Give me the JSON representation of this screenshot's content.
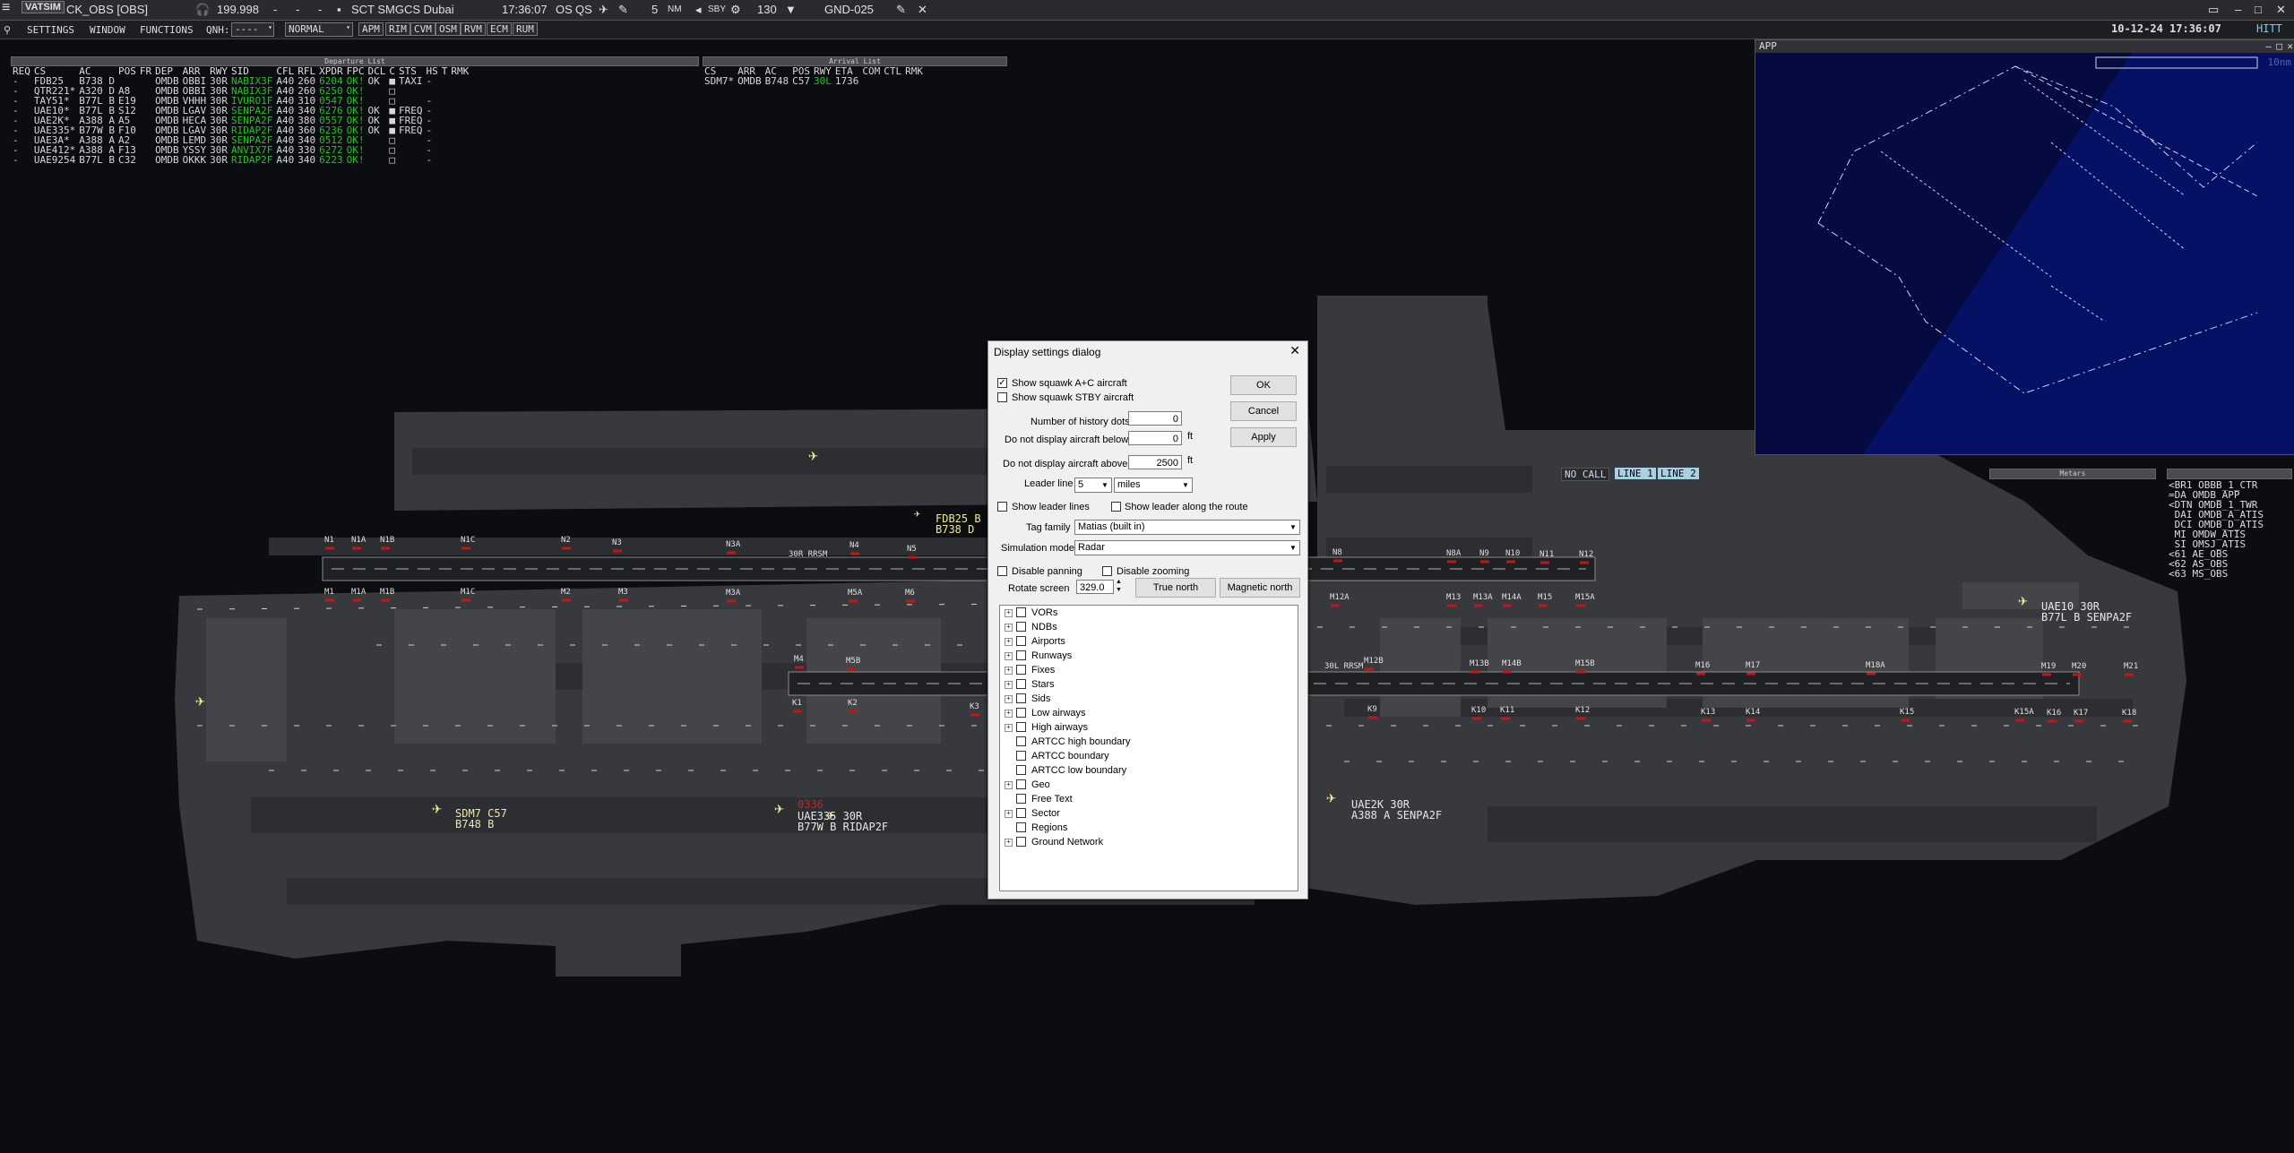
{
  "topbar": {
    "brand": "VATSIM",
    "callsign": "CK_OBS [OBS]",
    "frequency": "199.998",
    "dash1": "-",
    "dash2": "-",
    "dash3": "-",
    "sector_file": "SCT SMGCS Dubai",
    "time": "17:36:07",
    "os": "OS",
    "qs": "QS",
    "range": "5",
    "range_unit": "NM",
    "sby": "SBY",
    "squawk": "130",
    "position": "GND-025"
  },
  "menubar": {
    "settings": "SETTINGS",
    "window": "WINDOW",
    "functions": "FUNCTIONS",
    "qnh_label": "QNH:",
    "qnh_value": "----",
    "mode_value": "NORMAL",
    "apm": "APM",
    "rim": "RIM",
    "cvm": "CVM",
    "osm": "OSM",
    "rvm": "RVM",
    "ecm": "ECM",
    "rum": "RUM",
    "datetime": "10-12-24 17:36:07",
    "hitt": "HITT"
  },
  "departure_list": {
    "title": "Departure List",
    "headers": [
      "REQ",
      "CS",
      "AC",
      "POS",
      "FR",
      "DEP",
      "ARR",
      "RWY",
      "SID",
      "CFL",
      "RFL",
      "XPDR",
      "FPC",
      "DCL",
      "C",
      "STS",
      "HS",
      "T",
      "RMK"
    ],
    "rows": [
      [
        "-",
        "FDB25",
        "B738 D",
        "",
        "",
        "OMDB",
        "OBBI",
        "30R",
        "NABIX3F",
        "A40",
        "260",
        "6204",
        "OK!",
        "OK",
        "■",
        "TAXI",
        "-"
      ],
      [
        "-",
        "QTR221*",
        "A320 D",
        "A8",
        "",
        "OMDB",
        "OBBI",
        "30R",
        "NABIX3F",
        "A40",
        "260",
        "6250",
        "OK!",
        "",
        "□",
        "",
        ""
      ],
      [
        "-",
        "TAY51*",
        "B77L B",
        "E19",
        "",
        "OMDB",
        "VHHH",
        "30R",
        "IVURO1F",
        "A40",
        "310",
        "0547",
        "OK!",
        "",
        "□",
        "",
        "-"
      ],
      [
        "-",
        "UAE10*",
        "B77L B",
        "S12",
        "",
        "OMDB",
        "LGAV",
        "30R",
        "SENPA2F",
        "A40",
        "340",
        "6276",
        "OK!",
        "OK",
        "■",
        "FREQ",
        "-"
      ],
      [
        "-",
        "UAE2K*",
        "A388 A",
        "A5",
        "",
        "OMDB",
        "HECA",
        "30R",
        "SENPA2F",
        "A40",
        "380",
        "0557",
        "OK!",
        "OK",
        "■",
        "FREQ",
        "-"
      ],
      [
        "-",
        "UAE335*",
        "B77W B",
        "F10",
        "",
        "OMDB",
        "LGAV",
        "30R",
        "RIDAP2F",
        "A40",
        "360",
        "6236",
        "OK!",
        "OK",
        "■",
        "FREQ",
        "-"
      ],
      [
        "-",
        "UAE3A*",
        "A388 A",
        "A2",
        "",
        "OMDB",
        "LEMD",
        "30R",
        "SENPA2F",
        "A40",
        "340",
        "0512",
        "OK!",
        "",
        "□",
        "",
        "-"
      ],
      [
        "-",
        "UAE412*",
        "A388 A",
        "F13",
        "",
        "OMDB",
        "YSSY",
        "30R",
        "ANVIX7F",
        "A40",
        "330",
        "6272",
        "OK!",
        "",
        "□",
        "",
        "-"
      ],
      [
        "-",
        "UAE9254",
        "B77L B",
        "C32",
        "",
        "OMDB",
        "OKKK",
        "30R",
        "RIDAP2F",
        "A40",
        "340",
        "6223",
        "OK!",
        "",
        "□",
        "",
        "-"
      ]
    ]
  },
  "arrival_list": {
    "title": "Arrival List",
    "headers": [
      "CS",
      "ARR",
      "AC",
      "POS",
      "RWY",
      "ETA",
      "COM",
      "CTL",
      "RMK"
    ],
    "rows": [
      [
        "SDM7*",
        "OMDB",
        "B748",
        "C57",
        "30L",
        "1736",
        "",
        "",
        ""
      ]
    ]
  },
  "app_window": {
    "title": "APP",
    "scale": "10nm"
  },
  "status_tags": {
    "no_call": "NO CALL",
    "line1": "LINE 1",
    "line2": "LINE 2",
    "metars": "Metars"
  },
  "atc_list": [
    "<BR1 OBBB_1_CTR",
    "=DA OMDB_APP",
    "<DTN OMDB_1_TWR",
    " DAI OMDB_A_ATIS",
    " DCI OMDB_D_ATIS",
    " MI OMDW_ATIS",
    " SI OMSJ_ATIS",
    "<61 AE_OBS",
    "<62 AS_OBS",
    "<63 MS_OBS"
  ],
  "runway_labels": {
    "north": "30R RRSM",
    "south": "30L RRSM"
  },
  "taxiway_labels": [
    "N1",
    "N1A",
    "N1B",
    "N1C",
    "N2",
    "N3",
    "N3A",
    "N4",
    "N5",
    "N8",
    "N8A",
    "N9",
    "N10",
    "N11",
    "N12",
    "M1",
    "M1A",
    "M1B",
    "M1C",
    "M2",
    "M3",
    "M3A",
    "M5A",
    "M6",
    "M12A",
    "M13",
    "M13A",
    "M14A",
    "M15",
    "M15A",
    "M4",
    "M5B",
    "M12B",
    "M13B",
    "M14B",
    "M15B",
    "M16",
    "M17",
    "M18A",
    "M19",
    "M20",
    "M21",
    "K1",
    "K2",
    "K3",
    "K9",
    "K10",
    "K11",
    "K12",
    "K13",
    "K14",
    "K15",
    "K15A",
    "K16",
    "K17",
    "K18"
  ],
  "aircraft_tags": [
    {
      "line1": "FDB25 B",
      "line2": "B738 D"
    },
    {
      "line1": "SDM7 C57",
      "line2": "B748 B"
    },
    {
      "line1": "UAE335 30R",
      "line2": "B77W B RIDAP2F",
      "squawk": "0336"
    },
    {
      "line1": "UAE2K 30R",
      "line2": "A388 A SENPA2F"
    },
    {
      "line1": "UAE10 30R",
      "line2": "B77L B SENPA2F"
    }
  ],
  "dialog": {
    "title": "Display settings dialog",
    "show_squawk_ac": "Show squawk A+C aircraft",
    "show_squawk_ac_checked": true,
    "show_squawk_stby": "Show squawk STBY aircraft",
    "history_dots_label": "Number of history dots",
    "history_dots_value": "0",
    "below_label": "Do not display aircraft below",
    "below_value": "0",
    "below_unit": "ft",
    "above_label": "Do not display aircraft above",
    "above_value": "2500",
    "above_unit": "ft",
    "leader_line_label": "Leader line",
    "leader_line_value": "5",
    "leader_unit": "miles",
    "show_leader_lines": "Show leader lines",
    "show_leader_route": "Show leader along the route",
    "tag_family_label": "Tag family",
    "tag_family_value": "Matias (built in)",
    "sim_mode_label": "Simulation mode",
    "sim_mode_value": "Radar",
    "disable_panning": "Disable panning",
    "disable_zooming": "Disable zooming",
    "rotate_label": "Rotate screen",
    "rotate_value": "329.0",
    "true_north": "True north",
    "magnetic_north": "Magnetic north",
    "ok": "OK",
    "cancel": "Cancel",
    "apply": "Apply",
    "tree": [
      {
        "label": "VORs",
        "expandable": true
      },
      {
        "label": "NDBs",
        "expandable": true
      },
      {
        "label": "Airports",
        "expandable": true
      },
      {
        "label": "Runways",
        "expandable": true
      },
      {
        "label": "Fixes",
        "expandable": true
      },
      {
        "label": "Stars",
        "expandable": true
      },
      {
        "label": "Sids",
        "expandable": true
      },
      {
        "label": "Low airways",
        "expandable": true
      },
      {
        "label": "High airways",
        "expandable": true
      },
      {
        "label": "ARTCC high boundary",
        "expandable": false
      },
      {
        "label": "ARTCC boundary",
        "expandable": false
      },
      {
        "label": "ARTCC low boundary",
        "expandable": false
      },
      {
        "label": "Geo",
        "expandable": true
      },
      {
        "label": "Free Text",
        "expandable": false
      },
      {
        "label": "Sector",
        "expandable": true
      },
      {
        "label": "Regions",
        "expandable": false
      },
      {
        "label": "Ground Network",
        "expandable": true
      }
    ]
  },
  "colors": {
    "background": "#0c0d10",
    "airport_surface": "#3a3b3e",
    "app_background": "#050a40",
    "ok_green": "#21c321",
    "aircraft_yellow": "#f0e89a",
    "stopbar_red": "#c01818"
  }
}
